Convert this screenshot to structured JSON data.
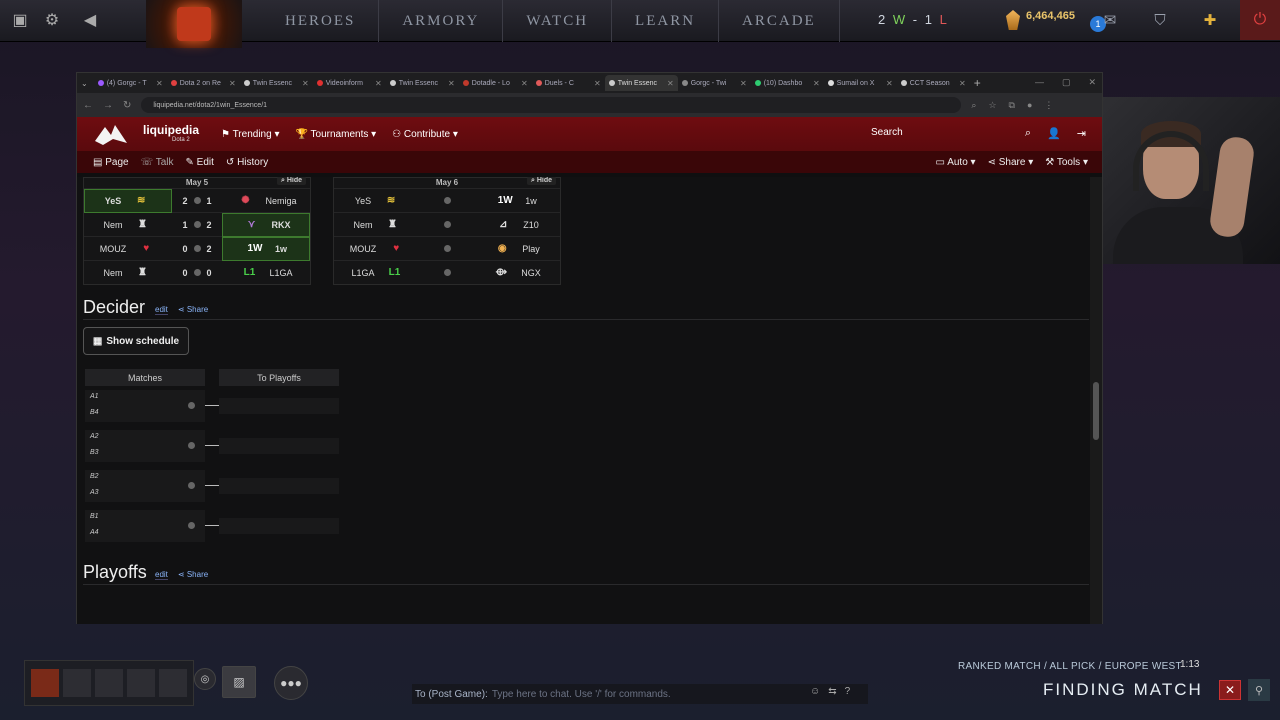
{
  "dota": {
    "nav": [
      "HEROES",
      "ARMORY",
      "WATCH",
      "LEARN",
      "ARCADE"
    ],
    "record": {
      "wins": "2",
      "sep1": "W",
      "dash": "-",
      "losses": "1",
      "sep2": "L"
    },
    "shards": "6,464,465",
    "notif_count": "1",
    "ranked_label": "RANKED MATCH / ALL PICK / EUROPE WEST",
    "timer": "1:13",
    "finding": "FINDING MATCH",
    "chat_to": "To (Post Game):",
    "chat_placeholder": "Type here to chat. Use '/' for commands."
  },
  "browser": {
    "tabs": [
      {
        "title": "(4) Gorgc - T",
        "color": "#9b59ff"
      },
      {
        "title": "Dota 2 on Re",
        "color": "#e04040"
      },
      {
        "title": "Twin Essenc",
        "color": "#cccccc"
      },
      {
        "title": "Videoinform",
        "color": "#e03030"
      },
      {
        "title": "Twin Essenc",
        "color": "#cccccc"
      },
      {
        "title": "Dotadle - Lo",
        "color": "#c0392b"
      },
      {
        "title": "Duels - C",
        "color": "#e05a5a"
      },
      {
        "title": "Twin Essenc",
        "color": "#cccccc",
        "active": true
      },
      {
        "title": "Gorgc - Twi",
        "color": "#888888"
      },
      {
        "title": "(10) Dashbo",
        "color": "#2ecc71"
      },
      {
        "title": "Sumail on X",
        "color": "#dddddd"
      },
      {
        "title": "CCT Season",
        "color": "#cccccc"
      }
    ],
    "url": "liquipedia.net/dota2/1win_Essence/1"
  },
  "lp": {
    "brand": "liquipedia",
    "sub": "Dota 2",
    "menu": [
      "Trending",
      "Tournaments",
      "Contribute"
    ],
    "search": "Search",
    "actions": [
      "Page",
      "Talk",
      "Edit",
      "History"
    ],
    "tools": [
      "Auto",
      "Share",
      "Tools"
    ],
    "day1": {
      "date": "May 5",
      "hide": "Hide",
      "rows": [
        {
          "t1": "YeS",
          "s1": "2",
          "s2": "1",
          "t2": "Nemiga",
          "win": "left"
        },
        {
          "t1": "Nem",
          "s1": "1",
          "s2": "2",
          "t2": "RKX",
          "win": "right"
        },
        {
          "t1": "MOUZ",
          "s1": "0",
          "s2": "2",
          "t2": "1w",
          "win": "right"
        },
        {
          "t1": "Nem",
          "s1": "0",
          "s2": "0",
          "t2": "L1GA",
          "win": ""
        }
      ]
    },
    "day2": {
      "date": "May 6",
      "hide": "Hide",
      "rows": [
        {
          "t1": "YeS",
          "t2": "1w"
        },
        {
          "t1": "Nem",
          "t2": "Z10"
        },
        {
          "t1": "MOUZ",
          "t2": "Play"
        },
        {
          "t1": "L1GA",
          "t2": "NGX"
        }
      ]
    },
    "decider": {
      "title": "Decider",
      "edit": "edit",
      "share": "Share"
    },
    "show_schedule": "Show schedule",
    "bracket": {
      "col1": "Matches",
      "col2": "To Playoffs",
      "matches": [
        {
          "a": "A1",
          "b": "B4"
        },
        {
          "a": "A2",
          "b": "B3"
        },
        {
          "a": "B2",
          "b": "A3"
        },
        {
          "a": "B1",
          "b": "A4"
        }
      ]
    },
    "playoffs": {
      "title": "Playoffs",
      "edit": "edit",
      "share": "Share"
    }
  }
}
